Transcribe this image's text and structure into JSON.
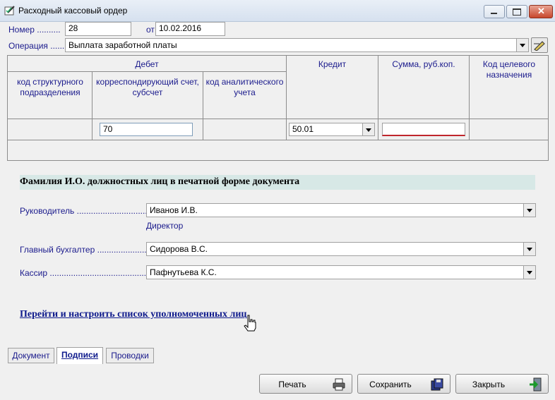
{
  "window": {
    "title": "Расходный кассовый ордер"
  },
  "header": {
    "number_label": "Номер ..........",
    "number_value": "28",
    "date_label": "от",
    "date_value": "10.02.2016",
    "operation_label": "Операция ......",
    "operation_value": "Выплата заработной платы"
  },
  "grid": {
    "debit_group": "Дебет",
    "col_structural": "код структурного подразделения",
    "col_account": "корреспондирующий счет, субсчет",
    "col_analytic": "код аналитического учета",
    "col_credit": "Кредит",
    "col_sum": "Сумма, руб.коп.",
    "col_purpose": "Код целевого назначения",
    "row_account_value": "70",
    "row_credit_value": "50.01",
    "row_sum_value": ""
  },
  "signatures": {
    "section_title": "Фамилия И.О. должностных лиц в печатной форме документа",
    "director_label": "Руководитель ..................................",
    "director_value": "Иванов И.В.",
    "director_position": "Директор",
    "chief_label": "Главный бухгалтер ........................",
    "chief_value": "Сидорова В.С.",
    "cashier_label": "Кассир ............................................",
    "cashier_value": "Пафнутьева К.С.",
    "link_text": "Перейти и настроить список уполномоченных лиц"
  },
  "tabs": [
    "Документ",
    "Подписи",
    "Проводки"
  ],
  "buttons": {
    "print": "Печать",
    "save": "Сохранить",
    "close": "Закрыть"
  },
  "colors": {
    "label": "#1a1a8c",
    "band": "#d7e8e6",
    "link": "#0e1a8c"
  }
}
